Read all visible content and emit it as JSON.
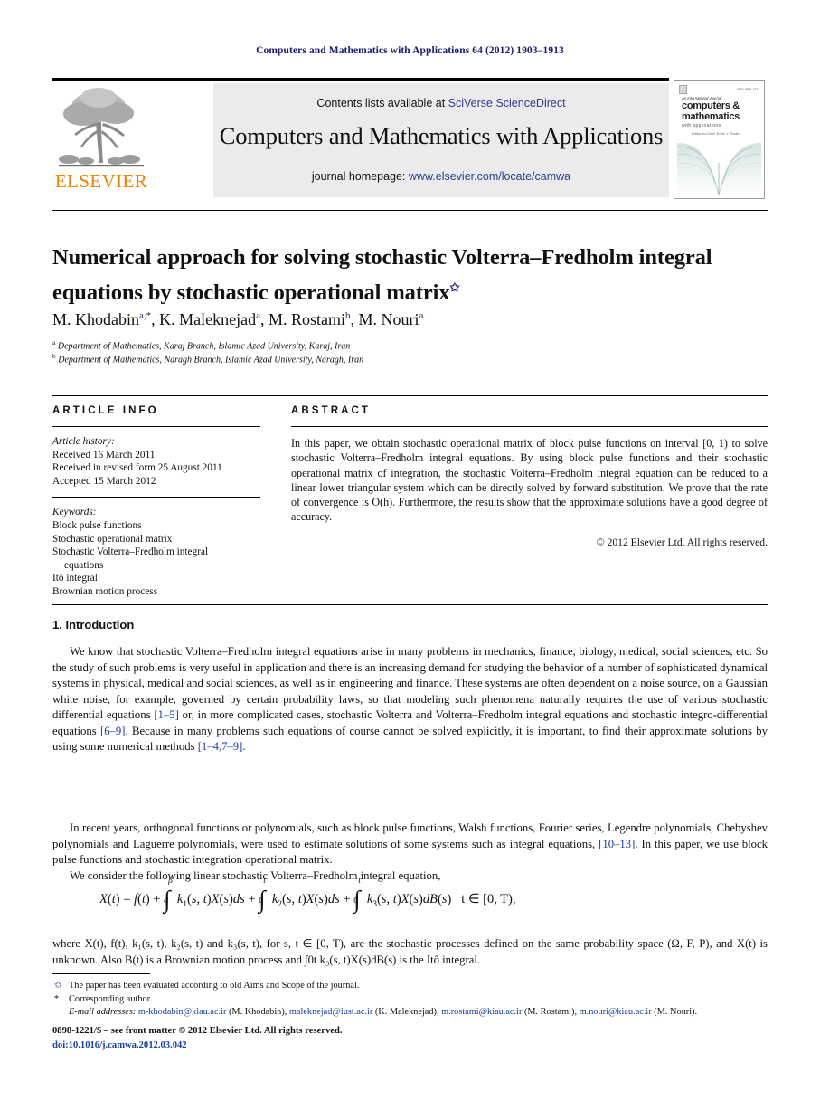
{
  "running_head": "Computers and Mathematics with Applications 64 (2012) 1903–1913",
  "masthead": {
    "publisher_name": "ELSEVIER",
    "publisher_logo_icon": "elsevier-tree-icon",
    "contents_prefix": "Contents lists available at ",
    "contents_link": "SciVerse ScienceDirect",
    "journal_title": "Computers and Mathematics with Applications",
    "homepage_prefix": "journal homepage: ",
    "homepage_link": "www.elsevier.com/locate/camwa",
    "cover": {
      "top_left_label": "An International Journal",
      "superscript_label": "An International Journal",
      "title_line1": "computers &",
      "title_line2": "mathematics",
      "title_line3": "with applications",
      "editor_line": "Editor-in-Chief: Ervin Y. Rodin"
    }
  },
  "article": {
    "title": "Numerical approach for solving stochastic Volterra–Fredholm integral equations by stochastic operational matrix",
    "title_footnote_mark": "✩",
    "authors": "M. Khodabin",
    "author_list": [
      {
        "name": "M. Khodabin",
        "marks": "a,*"
      },
      {
        "name": "K. Maleknejad",
        "marks": "a"
      },
      {
        "name": "M. Rostami",
        "marks": "b"
      },
      {
        "name": "M. Nouri",
        "marks": "a"
      }
    ],
    "affiliations": [
      {
        "mark": "a",
        "text": "Department of Mathematics, Karaj Branch, Islamic Azad University, Karaj, Iran"
      },
      {
        "mark": "b",
        "text": "Department of Mathematics, Naragh Branch, Islamic Azad University, Naragh, Iran"
      }
    ]
  },
  "article_info": {
    "heading": "ARTICLE INFO",
    "history_label": "Article history:",
    "history": [
      "Received 16 March 2011",
      "Received in revised form 25 August 2011",
      "Accepted 15 March 2012"
    ],
    "keywords_label": "Keywords:",
    "keywords": [
      "Block pulse functions",
      "Stochastic operational matrix",
      "Stochastic Volterra–Fredholm integral",
      "equations",
      "Itô integral",
      "Brownian motion process"
    ]
  },
  "abstract": {
    "heading": "ABSTRACT",
    "text": "In this paper, we obtain stochastic operational matrix of block pulse functions on interval [0, 1) to solve stochastic Volterra–Fredholm integral equations. By using block pulse functions and their stochastic operational matrix of integration, the stochastic Volterra–Fredholm integral equation can be reduced to a linear lower triangular system which can be directly solved by forward substitution. We prove that the rate of convergence is O(h). Furthermore, the results show that the approximate solutions have a good degree of accuracy.",
    "copyright": "© 2012 Elsevier Ltd. All rights reserved."
  },
  "body": {
    "section_title": "1. Introduction",
    "paragraph1_a": "We know that stochastic Volterra–Fredholm integral equations arise in many problems in mechanics, finance, biology, medical, social sciences, etc. So the study of such problems is very useful in application and there is an increasing demand for studying the behavior of a number of sophisticated dynamical systems in physical, medical and social sciences, as well as in engineering and finance. These systems are often dependent on a noise source, on a Gaussian white noise, for example, governed by certain probability laws, so that modeling such phenomena naturally requires the use of various stochastic differential equations ",
    "ref1": "[1–5]",
    "paragraph1_b": " or, in more complicated cases, stochastic Volterra and Volterra–Fredholm integral equations and stochastic integro-differential equations ",
    "ref2": "[6–9]",
    "paragraph1_c": ". Because in many problems such equations of course cannot be solved explicitly, it is important, to find their approximate solutions by using some numerical methods ",
    "ref3": "[1–4,7–9]",
    "paragraph1_d": ".",
    "paragraph2_a": "In recent years, orthogonal functions or polynomials, such as block pulse functions, Walsh functions, Fourier series, Legendre polynomials, Chebyshev polynomials and Laguerre polynomials, were used to estimate solutions of some systems such as integral equations, ",
    "ref4": "[10–13]",
    "paragraph2_b": ". In this paper, we use block pulse functions and stochastic integration operational matrix.",
    "paragraph3": "We consider the following linear stochastic Volterra–Fredholm integral equation,",
    "equation": "X(t) = f(t) + ∫αβ k₁(s, t)X(s)ds + ∫0t k₂(s, t)X(s)ds + ∫0t k₃(s, t)X(s)dB(s)   t ∈ [0, T),",
    "equation_domain": "t ∈ [0, T),",
    "paragraph4": "where X(t), f(t), k₁(s, t), k₂(s, t) and k₃(s, t), for s, t ∈ [0, T), are the stochastic processes defined on the same probability space (Ω, F, P), and X(t) is unknown. Also B(t) is a Brownian motion process and ∫0t k₃(s, t)X(s)dB(s) is the Itô integral."
  },
  "footnotes": {
    "star_mark": "✩",
    "star_text": "The paper has been evaluated according to old Aims and Scope of the journal.",
    "asterisk_mark": "*",
    "asterisk_text": "Corresponding author.",
    "email_label": "E-mail addresses:",
    "emails": [
      {
        "address": "m-khodabin@kiau.ac.ir",
        "owner": "(M. Khodabin)"
      },
      {
        "address": "maleknejad@iust.ac.ir",
        "owner": "(K. Maleknejad)"
      },
      {
        "address": "m.rostami@kiau.ac.ir",
        "owner": "(M. Rostami)"
      },
      {
        "address": "m.nouri@kiau.ac.ir",
        "owner": "(M. Nouri)."
      }
    ]
  },
  "imprint": {
    "issn_line": "0898-1221/$ – see front matter © 2012 Elsevier Ltd. All rights reserved.",
    "doi_line": "doi:10.1016/j.camwa.2012.03.042"
  }
}
